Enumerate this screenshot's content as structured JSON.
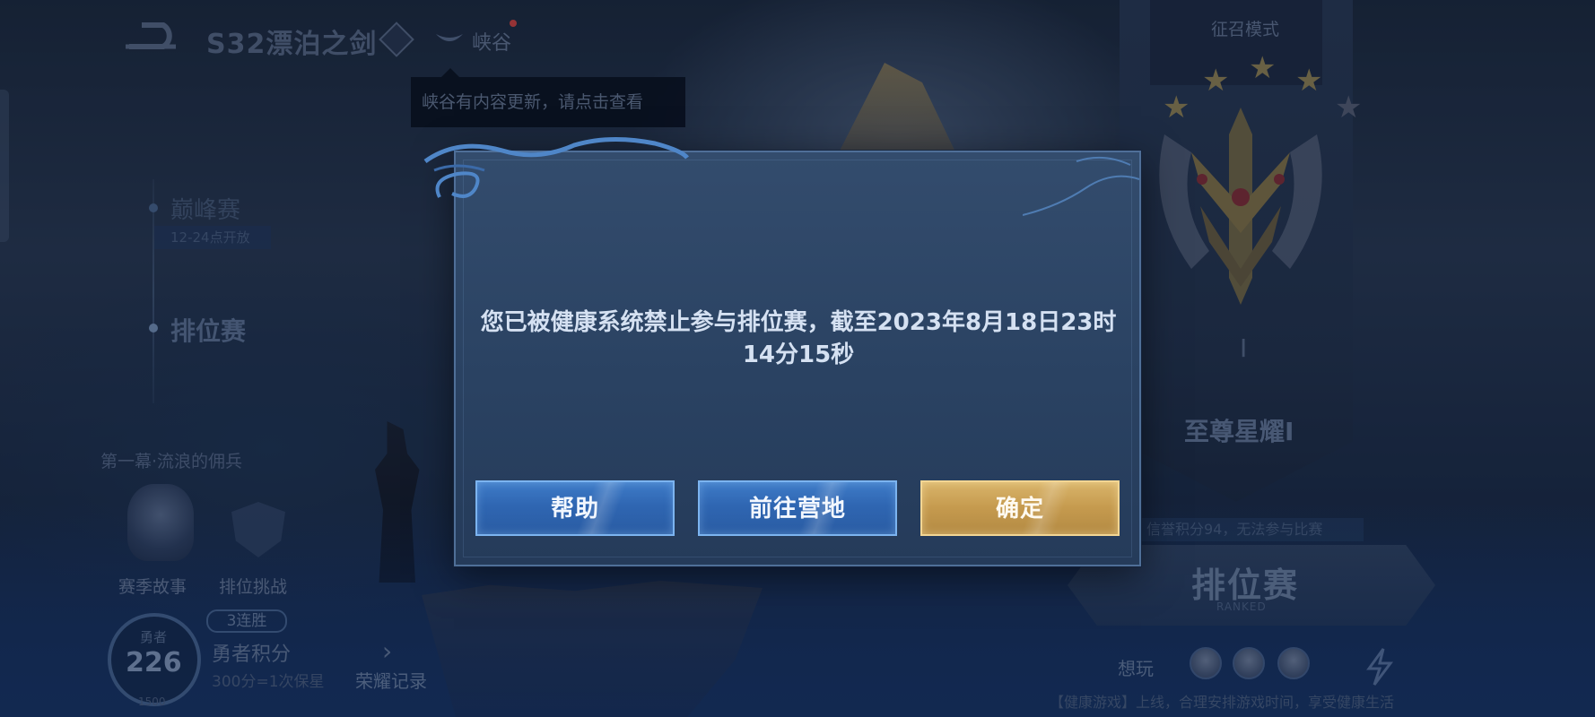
{
  "top_bar": {
    "season_title": "S32漂泊之剑",
    "valley_label": "峡谷",
    "tooltip": "峡谷有内容更新，请点击查看"
  },
  "left_panel": {
    "peak_match": "巅峰赛",
    "peak_match_sub": "12-24点开放",
    "rank_match": "排位赛",
    "chapter": "第一幕·流浪的佣兵",
    "season_story": "赛季故事",
    "rank_challenge": "排位挑战",
    "score_label": "勇者",
    "score_value": "226",
    "score_bottom": "1500",
    "streak": "3连胜",
    "brave_score": "勇者积分",
    "brave_note": "300分=1次保星",
    "honor_record": "荣耀记录"
  },
  "right_panel": {
    "summon_mode": "征召模式",
    "stars_filled": 4,
    "stars_total": 5,
    "tier_roman": "I",
    "tier_name": "至尊星耀I",
    "match_strip": "信誉积分94，无法参与比赛",
    "rank_button": "排位赛",
    "rank_button_sub": "RANKED",
    "want_play": "想玩",
    "health_footer": "【健康游戏】上线，合理安排游戏时间，享受健康生活"
  },
  "dialog": {
    "message": "您已被健康系统禁止参与排位赛，截至2023年8月18日23时14分15秒",
    "buttons": {
      "help": "帮助",
      "camp": "前往营地",
      "confirm": "确定"
    }
  },
  "colors": {
    "dialog_bg": "#2a4262",
    "dialog_border": "#4f6f98",
    "blue_button": "#2f66b2",
    "gold_button": "#c59a4e",
    "message_text": "#d5e1f2"
  },
  "icons": {
    "back": "back-arrow-icon",
    "season_badge": "diamond-badge-icon",
    "valley": "wing-icon",
    "emblem": "rank-emblem-icon",
    "lightning": "lightning-icon"
  }
}
